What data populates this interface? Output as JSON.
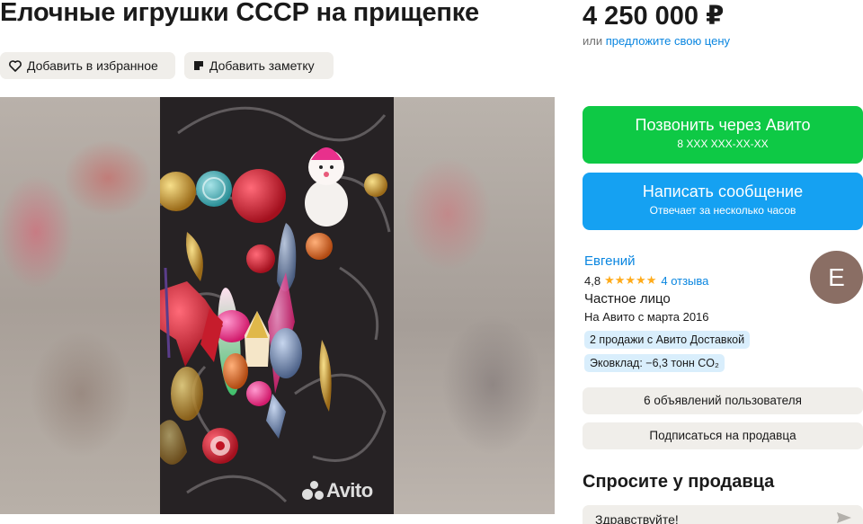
{
  "listing": {
    "title": "Елочные игрушки СССР на прищепке",
    "price": "4 250 000 ₽",
    "price_or": "или",
    "price_offer_link": "предложите свою цену"
  },
  "actions": {
    "favorite_label": "Добавить в избранное",
    "note_label": "Добавить заметку"
  },
  "gallery": {
    "watermark": "Avito"
  },
  "contact": {
    "call_label": "Позвонить через Авито",
    "call_phone": "8 XXX XXX-XX-XX",
    "message_label": "Написать сообщение",
    "message_sub": "Отвечает за несколько часов"
  },
  "seller": {
    "name": "Евгений",
    "rating": "4,8",
    "stars": "★★★★★",
    "reviews": "4 отзыва",
    "type": "Частное лицо",
    "since": "На Авито с марта 2016",
    "tags": [
      "2 продажи с Авито Доставкой",
      "Эковклад: −6,3 тонн CO₂"
    ],
    "avatar_letter": "E",
    "ads_label": "6 объявлений пользователя",
    "subscribe_label": "Подписаться на продавца"
  },
  "ask": {
    "title": "Спросите у продавца",
    "input_value": "Здравствуйте!"
  },
  "colors": {
    "call_green": "#0ec945",
    "message_blue": "#15a1f2",
    "link_blue": "#0a86e0",
    "star_orange": "#ffab1a",
    "chip_gray": "#f0eeea",
    "tag_blue": "#d9eefc"
  }
}
